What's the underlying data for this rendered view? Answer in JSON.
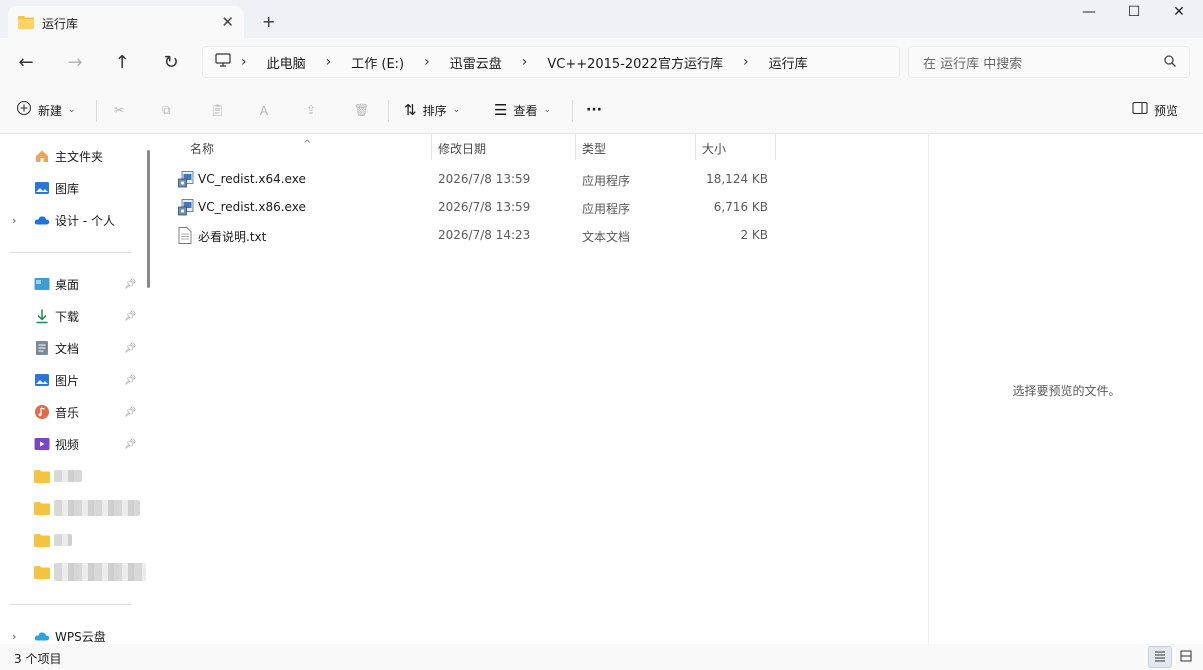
{
  "window": {
    "tab_title": "运行库",
    "new_tab": "+"
  },
  "nav": {
    "breadcrumbs": [
      "此电脑",
      "工作 (E:)",
      "迅雷云盘",
      "VC++2015-2022官方运行库",
      "运行库"
    ],
    "search_placeholder": "在 运行库 中搜索"
  },
  "toolbar": {
    "new_label": "新建",
    "sort_label": "排序",
    "view_label": "查看",
    "more_label": "···",
    "preview_label": "预览"
  },
  "sidebar": {
    "top_items": [
      {
        "label": "主文件夹",
        "icon": "home-icon"
      },
      {
        "label": "图库",
        "icon": "gallery-icon"
      },
      {
        "label": "设计 - 个人",
        "icon": "onedrive-cloud-icon"
      }
    ],
    "pinned_items": [
      {
        "label": "桌面",
        "icon": "desktop-icon"
      },
      {
        "label": "下载",
        "icon": "download-icon"
      },
      {
        "label": "文档",
        "icon": "document-icon"
      },
      {
        "label": "图片",
        "icon": "pictures-icon"
      },
      {
        "label": "音乐",
        "icon": "music-icon"
      },
      {
        "label": "视频",
        "icon": "video-icon"
      }
    ],
    "bottom_items": [
      {
        "label": "WPS云盘",
        "icon": "wps-cloud-icon"
      }
    ]
  },
  "filelist": {
    "columns": [
      "名称",
      "修改日期",
      "类型",
      "大小"
    ],
    "rows": [
      {
        "name": "VC_redist.x64.exe",
        "date": "2026/7/8 13:59",
        "type": "应用程序",
        "size": "18,124 KB",
        "icon": "installer-icon"
      },
      {
        "name": "VC_redist.x86.exe",
        "date": "2026/7/8 13:59",
        "type": "应用程序",
        "size": "6,716 KB",
        "icon": "installer-icon"
      },
      {
        "name": "必看说明.txt",
        "date": "2026/7/8 14:23",
        "type": "文本文档",
        "size": "2 KB",
        "icon": "text-file-icon"
      }
    ]
  },
  "preview": {
    "message": "选择要预览的文件。"
  },
  "status": {
    "item_count": "3 个项目"
  },
  "colors": {
    "folder": "#f6c343",
    "accent": "#1f6fd1",
    "tabbar_bg": "#eef1f6"
  }
}
